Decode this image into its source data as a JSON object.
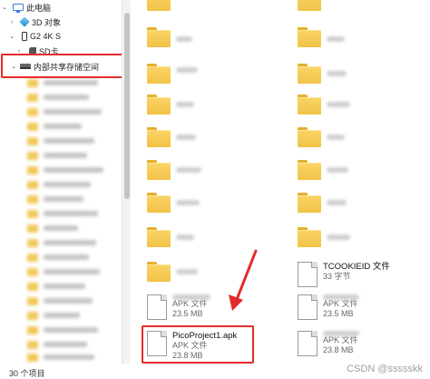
{
  "nav": {
    "this_pc": "此电脑",
    "objects_3d": "3D 对象",
    "device": "G2 4K S",
    "sd_card": "SD卡",
    "internal_storage": "内部共享存储空间"
  },
  "files": {
    "tcookie": {
      "name": "TCOOKIEID 文件",
      "sub": "33 字节"
    },
    "apk_a": {
      "type": "APK 文件",
      "size": "23.5 MB"
    },
    "apk_b": {
      "type": "APK 文件",
      "size": "23.5 MB"
    },
    "pico": {
      "name": "PicoProject1.apk",
      "type": "APK 文件",
      "size": "23.8 MB"
    },
    "apk_c": {
      "type": "APK 文件",
      "size": "23.8 MB"
    }
  },
  "status": {
    "item_count": "30 个项目"
  },
  "watermark": "CSDN @ssssskk",
  "colors": {
    "highlight": "#e32b2b",
    "folder": "#f1c347",
    "accent": "#3a7fd5"
  }
}
